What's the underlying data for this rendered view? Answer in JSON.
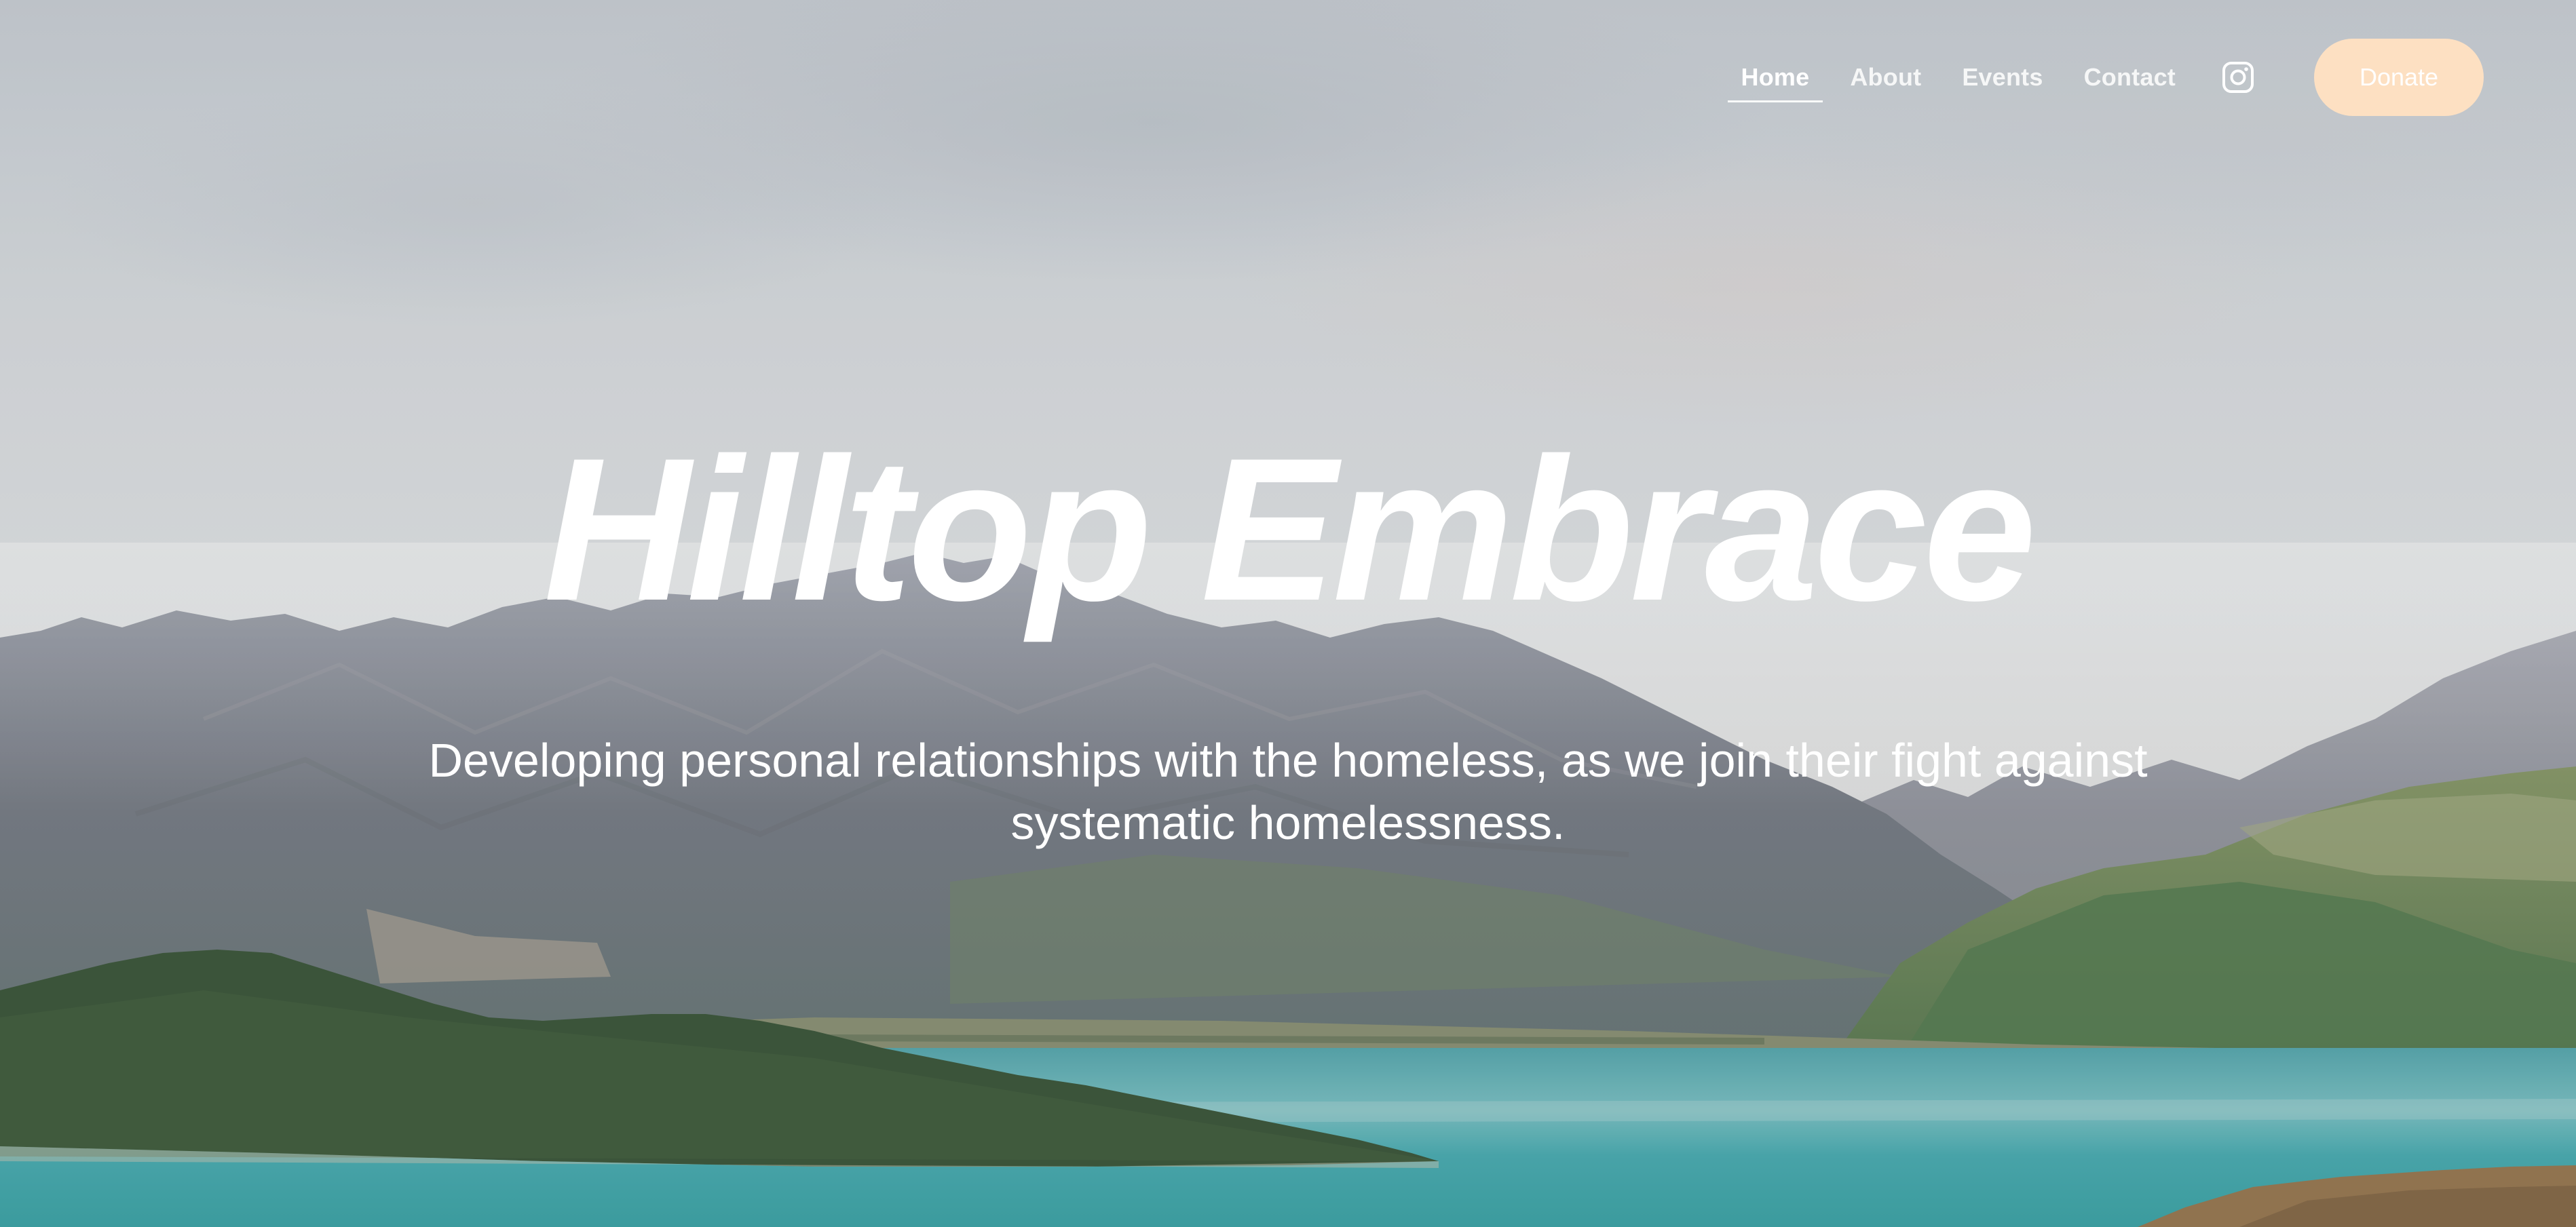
{
  "nav": {
    "items": [
      {
        "label": "Home",
        "active": true
      },
      {
        "label": "About",
        "active": false
      },
      {
        "label": "Events",
        "active": false
      },
      {
        "label": "Contact",
        "active": false
      }
    ],
    "social_icon": "instagram-icon",
    "donate_label": "Donate"
  },
  "hero": {
    "title": "Hilltop Embrace",
    "subtitle": "Developing personal relationships with the homeless, as we join their fight against systematic homelessness."
  },
  "colors": {
    "donate_bg": "#fde0c2",
    "text": "#ffffff",
    "lake": "#3f9ea3",
    "hill": "#2f4a2e"
  }
}
